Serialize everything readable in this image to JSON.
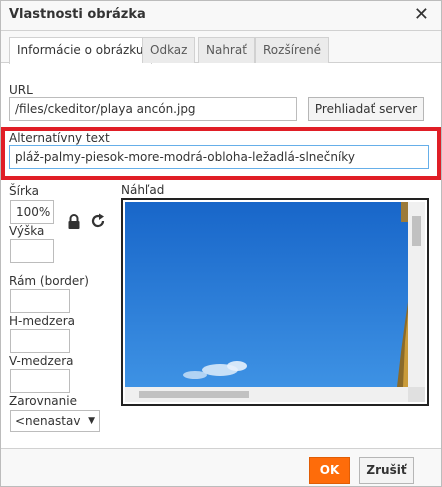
{
  "dialog": {
    "title": "Vlastnosti obrázka",
    "close_symbol": "✕"
  },
  "tabs": [
    {
      "label": "Informácie o obrázku",
      "active": true
    },
    {
      "label": "Odkaz",
      "active": false
    },
    {
      "label": "Nahrať",
      "active": false
    },
    {
      "label": "Rozšírené",
      "active": false
    }
  ],
  "url": {
    "label": "URL",
    "value": "/files/ckeditor/playa ancón.jpg",
    "browse_button": "Prehliadať server"
  },
  "alt_text": {
    "label": "Alternatívny text",
    "value": "pláž-palmy-piesok-more-modrá-obloha-ležadlá-slnečníky"
  },
  "width": {
    "label": "Šírka",
    "value": "100%"
  },
  "height": {
    "label": "Výška",
    "value": ""
  },
  "border": {
    "label": "Rám (border)",
    "value": ""
  },
  "hspace": {
    "label": "H-medzera",
    "value": ""
  },
  "vspace": {
    "label": "V-medzera",
    "value": ""
  },
  "align": {
    "label": "Zarovnanie",
    "value": "<nenastav"
  },
  "preview": {
    "label": "Náhľad"
  },
  "icons": {
    "lock": "lock-icon",
    "reset": "reset-size-icon"
  },
  "footer": {
    "ok": "OK",
    "cancel": "Zrušiť"
  },
  "colors": {
    "ok_button": "#fe6c0a",
    "highlight_border": "#e01e26",
    "sky": "#2a82de"
  }
}
